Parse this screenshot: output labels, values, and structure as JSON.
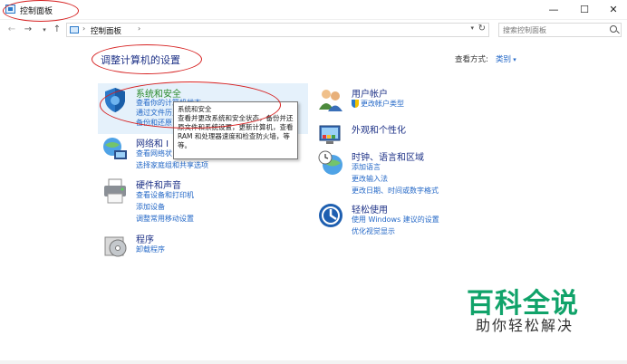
{
  "window": {
    "title": "控制面板",
    "minimize": "—",
    "maximize": "☐",
    "close": "✕"
  },
  "nav": {
    "back": "←",
    "forward": "→",
    "history": "▾",
    "up": "↑",
    "address_sep1": "›",
    "breadcrumb": "控制面板",
    "address_sep2": "›",
    "address_dropdown": "▾",
    "refresh": "↻",
    "search_placeholder": "搜索控制面板"
  },
  "main": {
    "heading": "调整计算机的设置",
    "view_by_label": "查看方式:",
    "view_by_value": "类别"
  },
  "categories": {
    "security": {
      "title": "系统和安全",
      "links": [
        "查看你的计算机状态",
        "通过文件历史",
        "备份和还原"
      ]
    },
    "network": {
      "title": "网络和 I",
      "links": [
        "查看网络状",
        "选择家庭组和共享选项"
      ]
    },
    "hardware": {
      "title": "硬件和声音",
      "links": [
        "查看设备和打印机",
        "添加设备",
        "调整常用移动设置"
      ]
    },
    "programs": {
      "title": "程序",
      "links": [
        "卸载程序"
      ]
    },
    "user": {
      "title": "用户帐户",
      "links": [
        "更改帐户类型"
      ]
    },
    "appearance": {
      "title": "外观和个性化",
      "links": []
    },
    "clock": {
      "title": "时钟、语言和区域",
      "links": [
        "添加语言",
        "更改输入法",
        "更改日期、时间或数字格式"
      ]
    },
    "ease": {
      "title": "轻松使用",
      "links": [
        "使用 Windows 建议的设置",
        "优化视觉显示"
      ]
    }
  },
  "tooltip": {
    "title": "系统和安全",
    "body": "查看并更改系统和安全状态，备份并还原文件和系统设置，更新计算机，查看 RAM 和处理器速度和检查防火墙，等等。"
  },
  "watermark": {
    "main": "百科全说",
    "sub": "助你轻松解决"
  },
  "colors": {
    "link_blue": "#2468c7",
    "heading_navy": "#1e3287",
    "security_green": "#2b8a2b",
    "annotation_red": "#d62020",
    "watermark_green": "#11a36a"
  }
}
